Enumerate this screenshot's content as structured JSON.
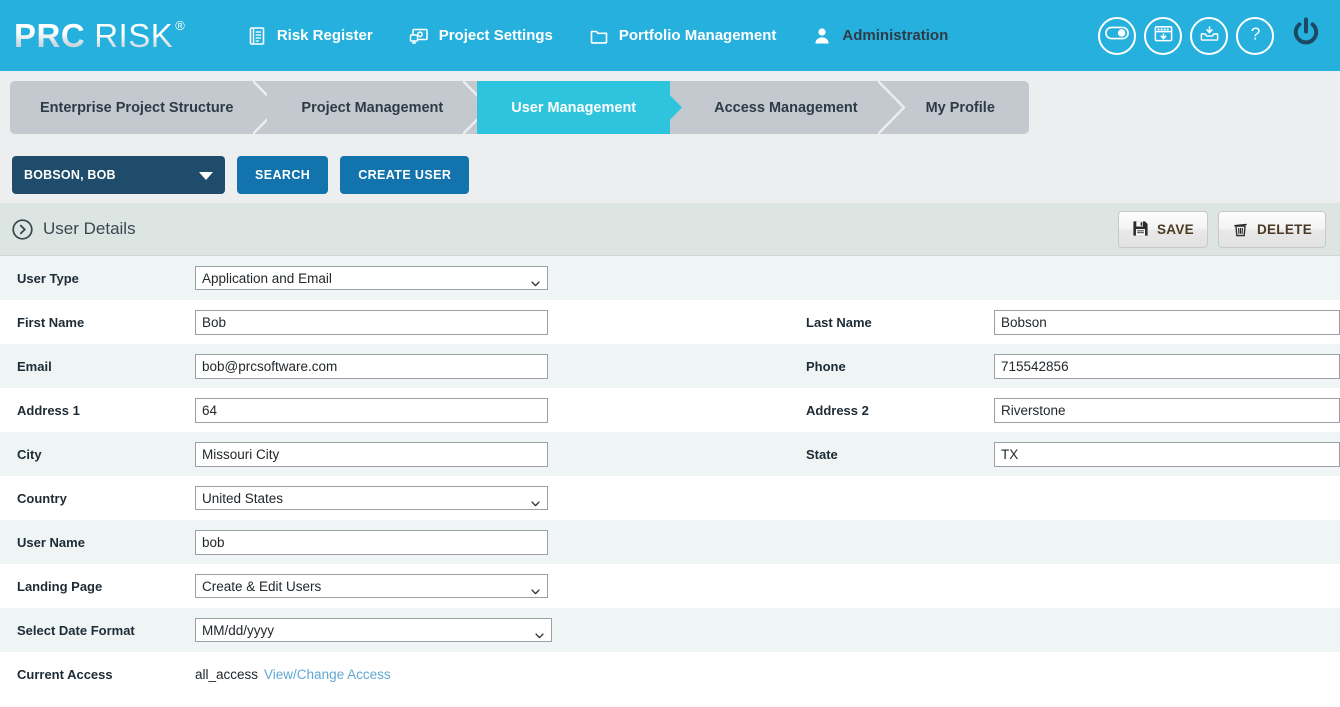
{
  "brand": {
    "name_bold": "PRC",
    "name_light": "RISK",
    "registered": "®",
    "header_bg": "#26b0de"
  },
  "topnav": {
    "items": [
      {
        "label": "Risk Register",
        "icon": "list-document-icon",
        "active": false
      },
      {
        "label": "Project Settings",
        "icon": "monitor-settings-icon",
        "active": false
      },
      {
        "label": "Portfolio Management",
        "icon": "folder-icon",
        "active": false
      },
      {
        "label": "Administration",
        "icon": "user-icon",
        "active": true
      }
    ],
    "right_icons": [
      {
        "name": "toggle-switch-icon"
      },
      {
        "name": "calendar-download-icon"
      },
      {
        "name": "inbox-download-icon"
      },
      {
        "name": "help-question-icon"
      },
      {
        "name": "power-off-icon"
      }
    ]
  },
  "breadcrumb": {
    "tabs": [
      {
        "label": "Enterprise Project Structure",
        "active": false
      },
      {
        "label": "Project Management",
        "active": false
      },
      {
        "label": "User Management",
        "active": true
      },
      {
        "label": "Access Management",
        "active": false
      },
      {
        "label": "My Profile",
        "active": false
      }
    ],
    "active_color": "#2ec4dd",
    "inactive_color": "#c3c9ce"
  },
  "actionbar": {
    "user_selector_value": "BOBSON, BOB",
    "search_label": "SEARCH",
    "create_user_label": "CREATE USER"
  },
  "section": {
    "title": "User Details",
    "toggle_icon": "circle-chevron-right-icon",
    "save_label": "SAVE",
    "save_icon": "floppy-disk-icon",
    "delete_label": "DELETE",
    "delete_icon": "trash-can-icon"
  },
  "form": {
    "rows": [
      {
        "left": {
          "label": "User Type",
          "type": "select",
          "value": "Application and Email"
        },
        "right": null
      },
      {
        "left": {
          "label": "First Name",
          "type": "text",
          "value": "Bob"
        },
        "right": {
          "label": "Last Name",
          "type": "text",
          "value": "Bobson"
        }
      },
      {
        "left": {
          "label": "Email",
          "type": "text",
          "value": "bob@prcsoftware.com"
        },
        "right": {
          "label": "Phone",
          "type": "text",
          "value": "715542856"
        }
      },
      {
        "left": {
          "label": "Address 1",
          "type": "text",
          "value": "64"
        },
        "right": {
          "label": "Address 2",
          "type": "text",
          "value": "Riverstone"
        }
      },
      {
        "left": {
          "label": "City",
          "type": "text",
          "value": "Missouri City"
        },
        "right": {
          "label": "State",
          "type": "text",
          "value": "TX"
        }
      },
      {
        "left": {
          "label": "Country",
          "type": "select",
          "value": "United States"
        },
        "right": null
      },
      {
        "left": {
          "label": "User Name",
          "type": "text",
          "value": "bob"
        },
        "right": null
      },
      {
        "left": {
          "label": "Landing Page",
          "type": "select",
          "value": "Create & Edit Users"
        },
        "right": null
      },
      {
        "left": {
          "label": "Select Date Format",
          "type": "select-wide",
          "value": "MM/dd/yyyy"
        },
        "right": null
      },
      {
        "left": {
          "label": "Current Access",
          "type": "static",
          "value": "all_access",
          "link": "View/Change Access"
        },
        "right": null
      }
    ]
  }
}
